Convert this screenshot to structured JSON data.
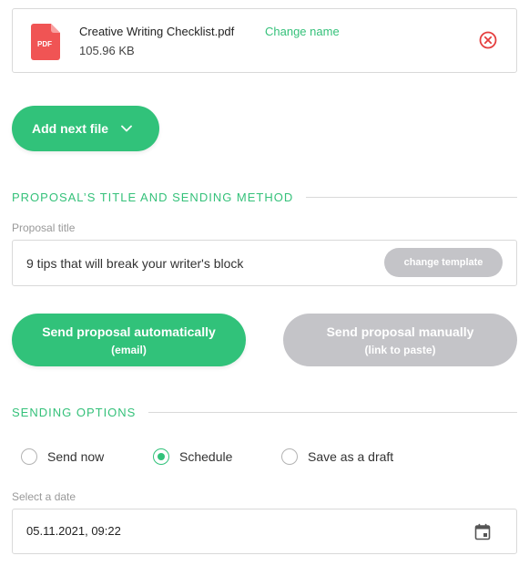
{
  "file": {
    "icon_label": "PDF",
    "name": "Creative Writing Checklist.pdf",
    "change_name_label": "Change name",
    "size": "105.96 KB"
  },
  "add_file_label": "Add next file",
  "section_title_method": "PROPOSAL’S TITLE AND SENDING METHOD",
  "proposal_title": {
    "label": "Proposal title",
    "value": "9 tips that will break your writer's block",
    "change_template_label": "change template"
  },
  "send_auto": {
    "label": "Send proposal automatically",
    "sub": "(email)"
  },
  "send_manual": {
    "label": "Send proposal manually",
    "sub": "(link to paste)"
  },
  "section_sending_options": "SENDING OPTIONS",
  "radio_options": [
    {
      "label": "Send now",
      "checked": false
    },
    {
      "label": "Schedule",
      "checked": true
    },
    {
      "label": "Save as a draft",
      "checked": false
    }
  ],
  "date": {
    "label": "Select a date",
    "value": "05.11.2021, 09:22"
  },
  "colors": {
    "accent": "#31c27a",
    "disabled": "#c4c4c8",
    "danger": "#e53e3e",
    "pdf": "#f05454"
  },
  "icons": [
    "pdf-file-icon",
    "close-circle-icon",
    "chevron-down-icon",
    "calendar-icon"
  ]
}
